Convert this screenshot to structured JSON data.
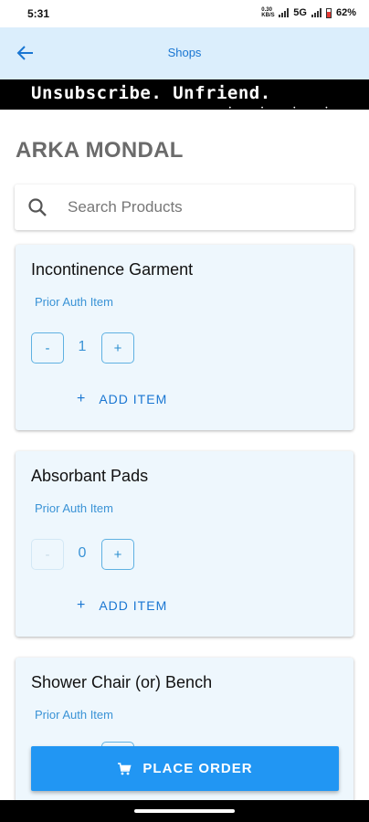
{
  "status_bar": {
    "time": "5:31",
    "net_speed": "0.30 KB/S",
    "network": "5G",
    "battery": "62%"
  },
  "app_bar": {
    "title": "Shops",
    "back_icon": "arrow-left-icon"
  },
  "banner": {
    "text": "Unsubscribe. Unfriend."
  },
  "customer": {
    "name": "ARKA MONDAL"
  },
  "search": {
    "placeholder": "Search Products",
    "value": ""
  },
  "products": [
    {
      "name": "Incontinence Garment",
      "subtitle": "Prior Auth Item",
      "minus": "-",
      "quantity": "1",
      "plus": "+",
      "add_label": "ADD ITEM",
      "add_icon": "+"
    },
    {
      "name": "Absorbant Pads",
      "subtitle": "Prior Auth Item",
      "minus": "-",
      "quantity": "0",
      "plus": "+",
      "add_label": "ADD ITEM",
      "add_icon": "+"
    },
    {
      "name": "Shower Chair (or) Bench",
      "subtitle": "Prior Auth Item"
    }
  ],
  "place_order": {
    "label": "PLACE ORDER",
    "icon": "cart-icon"
  },
  "colors": {
    "app_bar_bg": "#dbeefc",
    "accent": "#2196f3",
    "card_bg": "#eef7fd",
    "link": "#1976d2"
  }
}
